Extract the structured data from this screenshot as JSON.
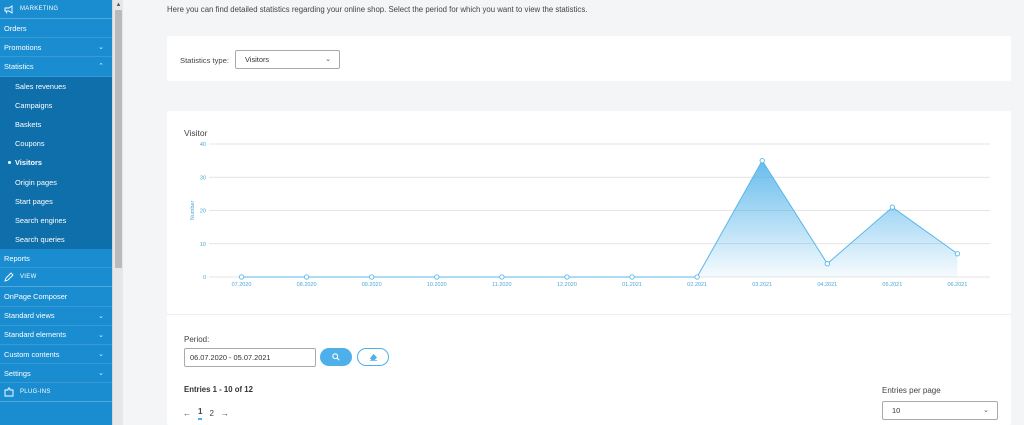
{
  "sidebar": {
    "sections": [
      {
        "title": "MARKETING",
        "icon": "megaphone-icon",
        "items": [
          {
            "label": "Orders",
            "chevron": false
          },
          {
            "label": "Promotions",
            "chevron": "down"
          },
          {
            "label": "Statistics",
            "chevron": "up"
          }
        ],
        "subitems": [
          "Sales revenues",
          "Campaigns",
          "Baskets",
          "Coupons",
          "Visitors",
          "Origin pages",
          "Start pages",
          "Search engines",
          "Search queries"
        ],
        "active_subitem": "Visitors",
        "after": [
          {
            "label": "Reports",
            "chevron": false
          }
        ]
      },
      {
        "title": "VIEW",
        "icon": "pen-icon",
        "items": [
          {
            "label": "OnPage Composer",
            "chevron": false
          },
          {
            "label": "Standard views",
            "chevron": "down"
          },
          {
            "label": "Standard elements",
            "chevron": "down"
          },
          {
            "label": "Custom contents",
            "chevron": "down"
          },
          {
            "label": "Settings",
            "chevron": "down"
          }
        ]
      },
      {
        "title": "PLUG-INS",
        "icon": "puzzle-icon"
      }
    ]
  },
  "intro_text": "Here you can find detailed statistics regarding your online shop. Select the period for which you want to view the statistics.",
  "stats_type": {
    "label": "Statistics type:",
    "value": "Visitors"
  },
  "period": {
    "label": "Period:",
    "value": "06.07.2020 - 05.07.2021"
  },
  "entries_text": "Entries 1 - 10 of 12",
  "pagination": {
    "prev": "←",
    "pages": [
      "1",
      "2"
    ],
    "current": "1",
    "next": "→"
  },
  "entries_per_page": {
    "label": "Entries per page",
    "value": "10"
  },
  "colors": {
    "sidebar": "#1a8cd0",
    "sidebar_sub": "#0f6fab",
    "accent": "#4db0ea",
    "line": "#5ab7ea"
  },
  "chart_data": {
    "type": "area",
    "title": "Visitor",
    "ylabel": "Number",
    "xlabel": "",
    "categories": [
      "07.2020",
      "08.2020",
      "09.2020",
      "10.2020",
      "11.2020",
      "12.2020",
      "01.2021",
      "02.2021",
      "03.2021",
      "04.2021",
      "05.2021",
      "06.2021"
    ],
    "values": [
      0,
      0,
      0,
      0,
      0,
      0,
      0,
      0,
      35,
      4,
      21,
      7
    ],
    "ylim": [
      0,
      40
    ],
    "yticks": [
      0,
      10,
      20,
      30,
      40
    ],
    "grid": true,
    "legend": "none"
  }
}
